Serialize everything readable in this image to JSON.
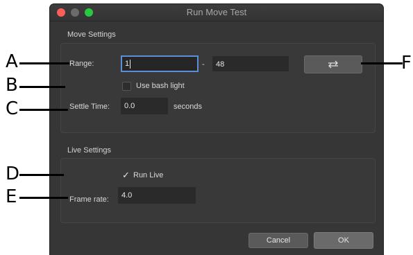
{
  "window": {
    "title": "Run Move Test"
  },
  "move_settings": {
    "title": "Move Settings",
    "range_label": "Range:",
    "range_start": "1",
    "range_separator": "-",
    "range_end": "48",
    "swap_icon": "swap-arrows-icon",
    "bash_light_label": "Use bash light",
    "bash_light_checked": false,
    "settle_label": "Settle Time:",
    "settle_value": "0.0",
    "settle_unit": "seconds"
  },
  "live_settings": {
    "title": "Live Settings",
    "run_live_label": "Run Live",
    "run_live_checked": true,
    "frame_rate_label": "Frame rate:",
    "frame_rate_value": "4.0"
  },
  "buttons": {
    "cancel": "Cancel",
    "ok": "OK"
  },
  "annotations": {
    "a": "A",
    "b": "B",
    "c": "C",
    "d": "D",
    "e": "E",
    "f": "F"
  }
}
